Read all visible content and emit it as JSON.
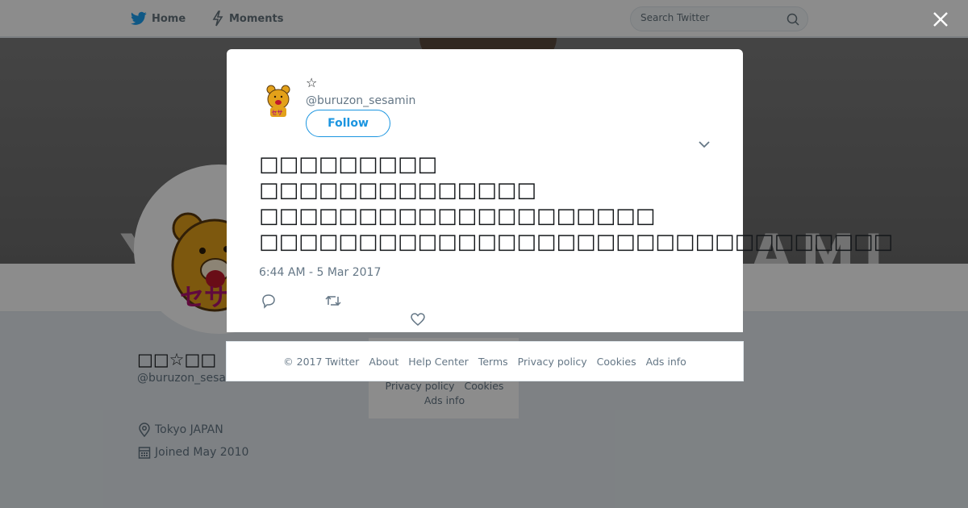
{
  "header": {
    "home_label": "Home",
    "moments_label": "Moments",
    "search_placeholder": "Search Twitter"
  },
  "banner": {
    "text_left": "Y",
    "text_right": "AMI"
  },
  "profile": {
    "name": "□□☆□□",
    "handle": "@buruzon_sesamin",
    "location": "Tokyo JAPAN",
    "joined": "Joined May 2010"
  },
  "side_footer": {
    "line1_a": "Privacy policy",
    "line1_b": "Cookies",
    "line2": "Ads info"
  },
  "tweet": {
    "display_name": "☆",
    "handle": "@buruzon_sesamin",
    "follow_label": "Follow",
    "text": "□□□□□□□□□\n□□□□□□□□□□□□□□\n□□□□□□□□□□□□□□□□□□□□\n□□□□□□□□□□□□□□□□□□□□□□□□□□□□□□□□",
    "timestamp": "6:44 AM - 5 Mar 2017"
  },
  "modal_footer": {
    "copyright": "© 2017 Twitter",
    "about": "About",
    "help": "Help Center",
    "terms": "Terms",
    "privacy": "Privacy policy",
    "cookies": "Cookies",
    "ads": "Ads info"
  },
  "colors": {
    "brand_blue": "#1da1f2",
    "follow_blue": "#1b95e0",
    "avatar_bear": "#e3a11a",
    "avatar_text": "#b0136f"
  }
}
